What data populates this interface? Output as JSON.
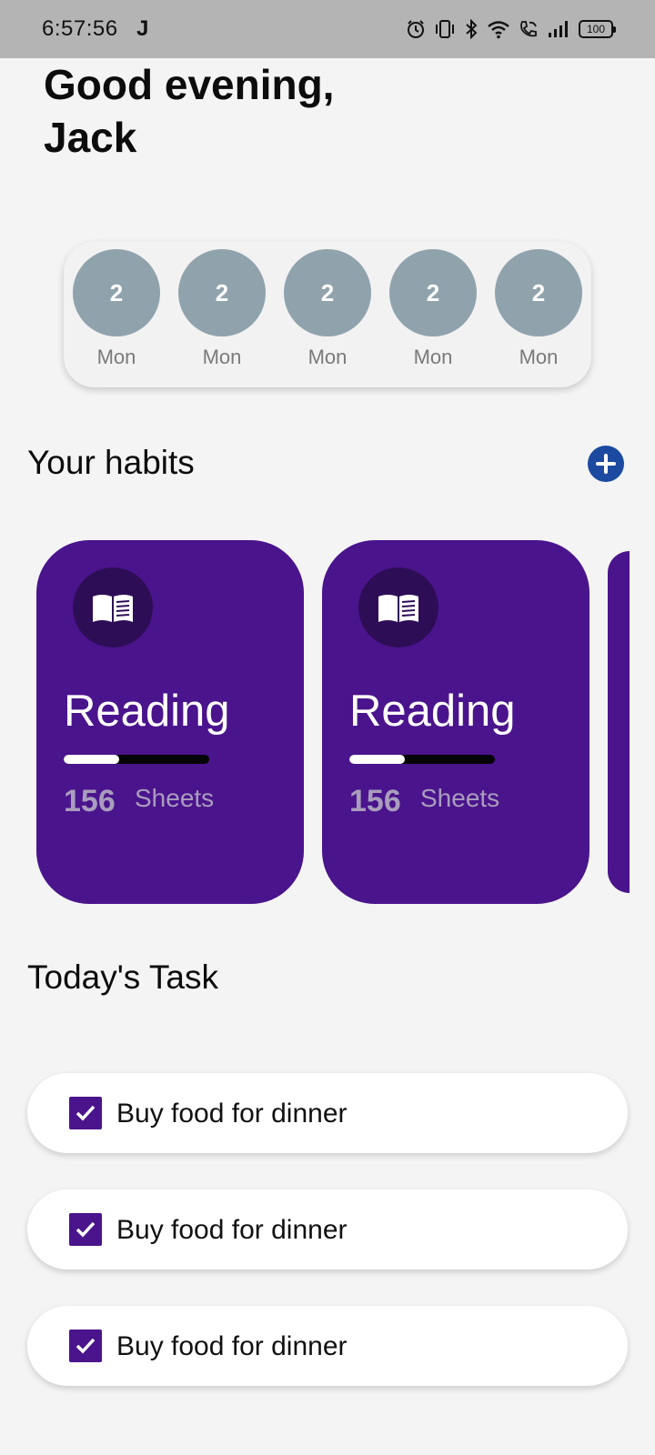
{
  "status_bar": {
    "time": "6:57:56",
    "app_indicator": "J",
    "battery": "100",
    "icons": [
      "alarm-icon",
      "vibrate-icon",
      "bluetooth-icon",
      "wifi-icon",
      "wifi-call-icon",
      "signal-icon",
      "battery-icon"
    ]
  },
  "greeting": {
    "line1": "Good evening,",
    "line2": "Jack"
  },
  "days": [
    {
      "number": "2",
      "label": "Mon"
    },
    {
      "number": "2",
      "label": "Mon"
    },
    {
      "number": "2",
      "label": "Mon"
    },
    {
      "number": "2",
      "label": "Mon"
    },
    {
      "number": "2",
      "label": "Mon"
    }
  ],
  "habits_section": {
    "title": "Your habits",
    "add_icon": "plus-icon"
  },
  "habits": [
    {
      "title": "Reading",
      "count": "156",
      "unit": "Sheets",
      "progress": 0.38,
      "icon": "book-icon"
    },
    {
      "title": "Reading",
      "count": "156",
      "unit": "Sheets",
      "progress": 0.38,
      "icon": "book-icon"
    }
  ],
  "tasks_section": {
    "title": "Today's Task"
  },
  "tasks": [
    {
      "label": "Buy food for dinner",
      "checked": true
    },
    {
      "label": "Buy food for dinner",
      "checked": true
    },
    {
      "label": "Buy food for dinner",
      "checked": true
    }
  ],
  "colors": {
    "habit_card": "#4a148c",
    "day_circle": "#90a3ad",
    "add_button": "#1b4aa0",
    "background": "#f4f4f4"
  }
}
